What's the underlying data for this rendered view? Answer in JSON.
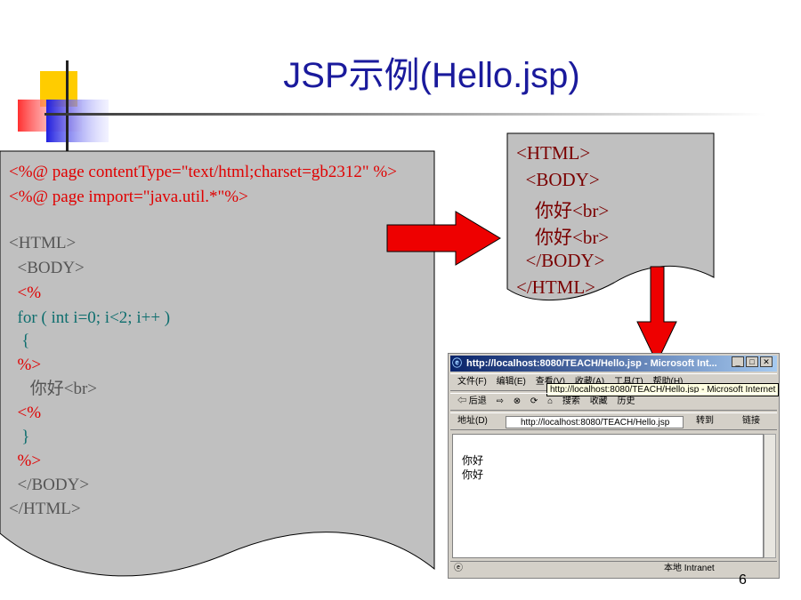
{
  "slide": {
    "title": "JSP示例(Hello.jsp)",
    "page_number": "6"
  },
  "source_code": [
    {
      "text": "<%@ page contentType=\"text/html;charset=gb2312\" %>",
      "color": "red"
    },
    {
      "text": "<%@ page import=\"java.util.*\"%>",
      "color": "red"
    },
    {
      "text": "<HTML>",
      "color": "gray"
    },
    {
      "text": "  <BODY>",
      "color": "gray"
    },
    {
      "text": "  <%",
      "color": "red"
    },
    {
      "text": "  for ( int i=0; i<2; i++ )",
      "color": "teal"
    },
    {
      "text": "   {",
      "color": "teal"
    },
    {
      "text": "  %>",
      "color": "red"
    },
    {
      "text": "     你好<br>",
      "color": "gray"
    },
    {
      "text": "  <%",
      "color": "red"
    },
    {
      "text": "   }",
      "color": "teal"
    },
    {
      "text": "  %>",
      "color": "red"
    },
    {
      "text": "  </BODY>",
      "color": "gray"
    },
    {
      "text": "</HTML>",
      "color": "gray"
    }
  ],
  "generated_html": [
    "<HTML>",
    "  <BODY>",
    "    你好<br>",
    "    你好<br>",
    "  </BODY>",
    "</HTML>"
  ],
  "browser": {
    "window_title": "http://localhost:8080/TEACH/Hello.jsp - Microsoft Int...",
    "menu": [
      "文件(F)",
      "编辑(E)",
      "查看(V)",
      "收藏(A)",
      "工具(T)",
      "帮助(H)"
    ],
    "tooltip": "http://localhost:8080/TEACH/Hello.jsp - Microsoft Internet",
    "toolbar": {
      "back": "⇦ 后退",
      "forward": "⇨",
      "stop": "⊗",
      "refresh": "⟳",
      "home": "⌂",
      "search": "搜索",
      "favorites": "收藏",
      "history": "历史"
    },
    "address_label": "地址(D)",
    "address_value": "http://localhost:8080/TEACH/Hello.jsp",
    "go_label": "转到",
    "links_label": "链接",
    "content": [
      "你好",
      "你好"
    ],
    "status_zone": "本地 Intranet"
  },
  "colors": {
    "title": "#1a1a9c",
    "code_red": "#e00000",
    "code_teal": "#0e6e6e",
    "arrow_red": "#ee0000"
  }
}
